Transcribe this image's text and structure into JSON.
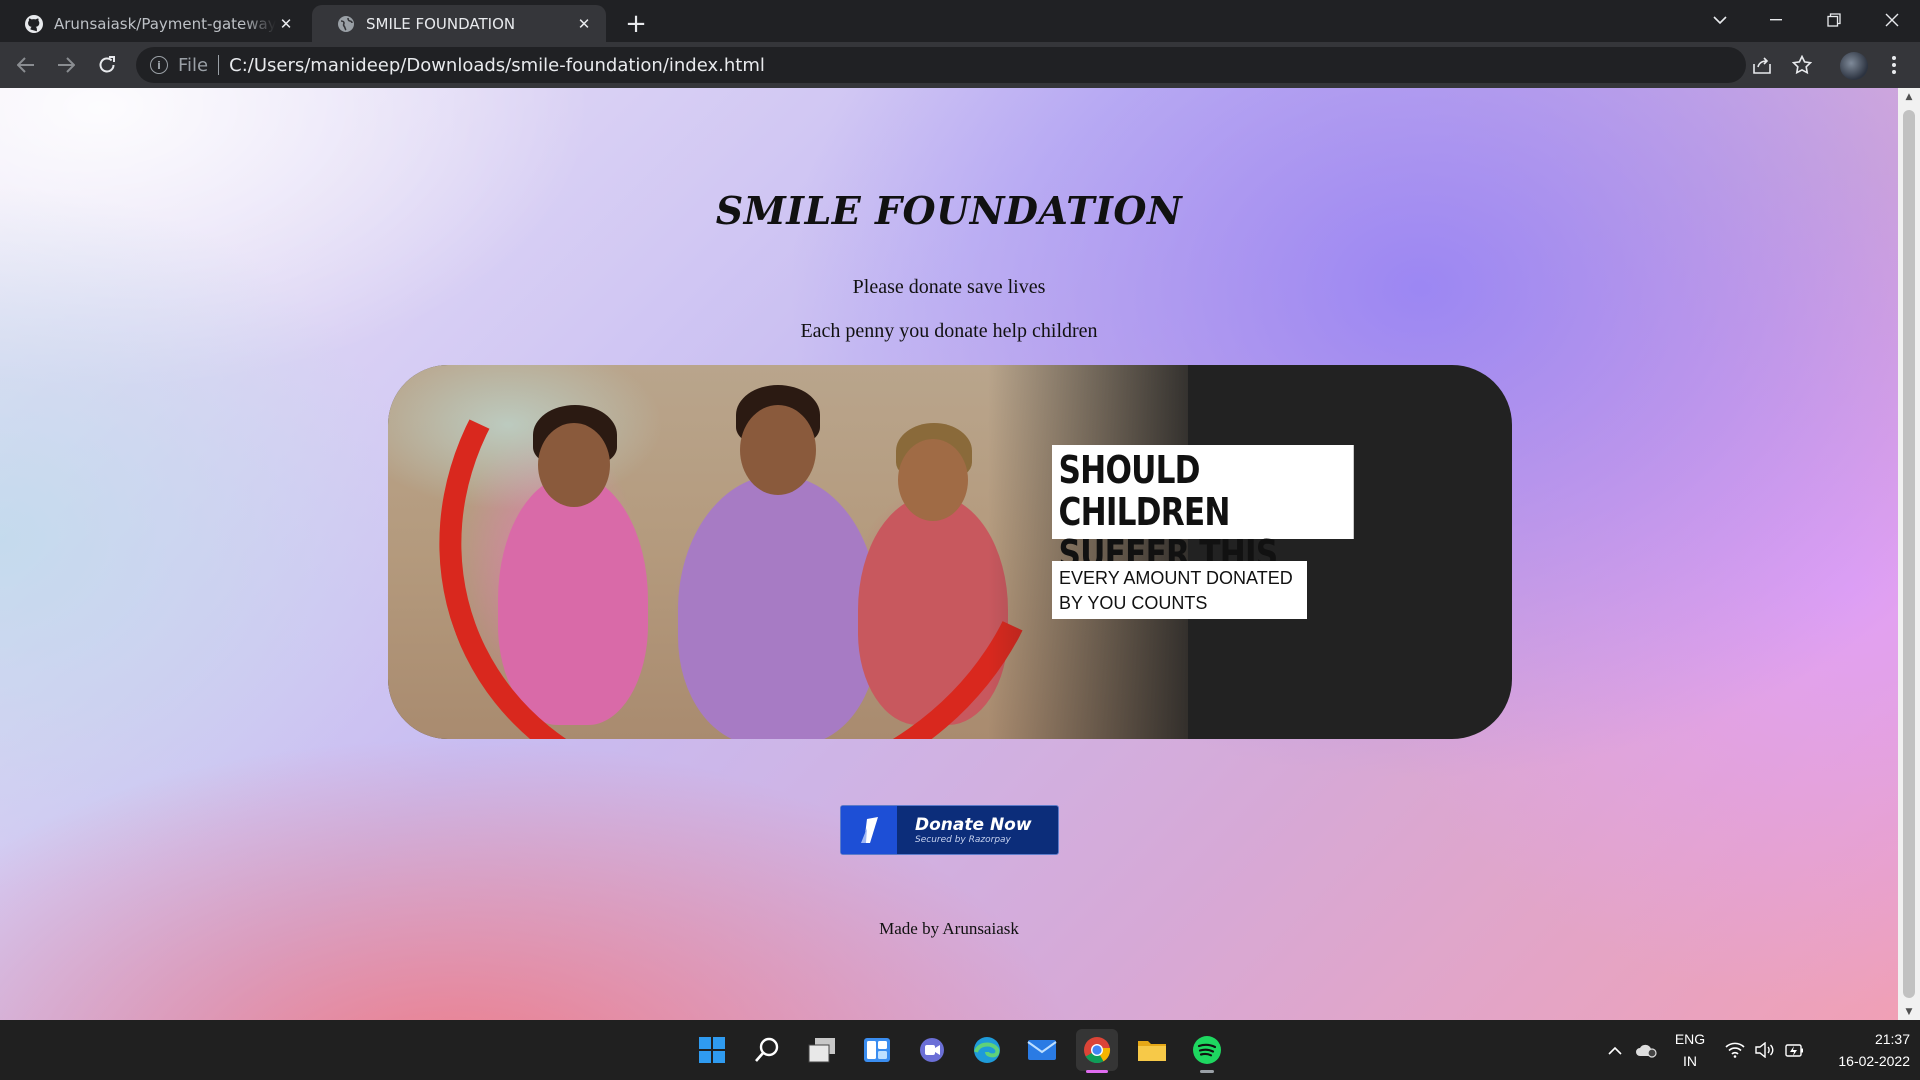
{
  "browser": {
    "tabs": [
      {
        "title": "Arunsaiask/Payment-gateway-: P",
        "icon": "github-icon",
        "active": false
      },
      {
        "title": "SMILE FOUNDATION",
        "icon": "globe-icon",
        "active": true
      }
    ],
    "address_bar": {
      "scheme_label": "File",
      "url": "C:/Users/manideep/Downloads/smile-foundation/index.html"
    }
  },
  "page": {
    "title": "SMILE FOUNDATION",
    "subtitle_1": "Please donate save lives",
    "subtitle_2": "Each penny you donate help children",
    "banner": {
      "headline_line1": "SHOULD CHILDREN",
      "headline_line2": "SUFFER THIS WAY?",
      "subline_line1": "EVERY AMOUNT DONATED",
      "subline_line2": "BY YOU COUNTS"
    },
    "donate_button": {
      "label": "Donate Now",
      "secured_by": "Secured by Razorpay"
    },
    "footer": "Made by Arunsaiask"
  },
  "taskbar": {
    "apps": [
      "windows-start",
      "search",
      "task-view",
      "widgets",
      "teams-chat",
      "edge",
      "mail",
      "chrome",
      "file-explorer",
      "spotify"
    ],
    "tray": {
      "language_line1": "ENG",
      "language_line2": "IN",
      "time": "21:37",
      "date": "16-02-2022"
    }
  },
  "colors": {
    "accent_red": "#d9281e",
    "razorpay_blue": "#0c2d7a",
    "chrome_dark": "#202124"
  }
}
